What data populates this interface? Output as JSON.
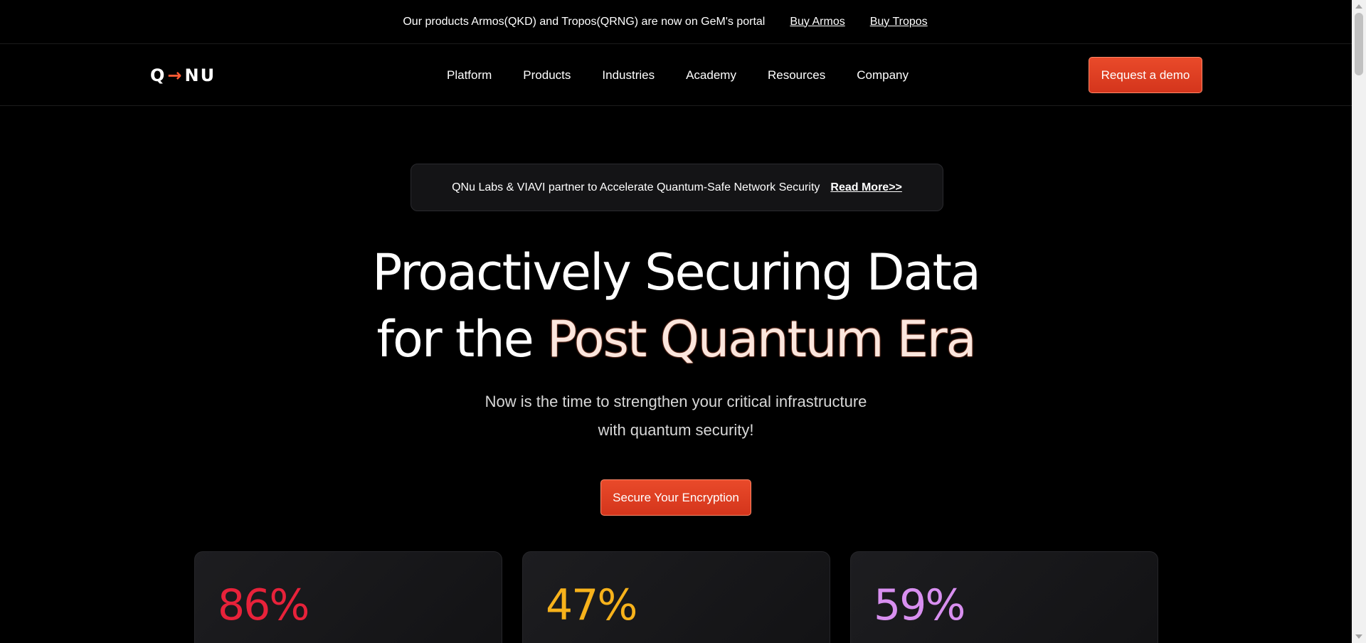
{
  "announcement": {
    "message": "Our products Armos(QKD) and Tropos(QRNG) are now on GeM's portal",
    "link1": "Buy Armos",
    "link2": "Buy Tropos"
  },
  "nav": {
    "logo_left": "Q",
    "logo_arrow": "→",
    "logo_right": "NU",
    "items": [
      "Platform",
      "Products",
      "Industries",
      "Academy",
      "Resources",
      "Company"
    ],
    "demo_button": "Request a demo"
  },
  "news": {
    "text": "QNu Labs & VIAVI partner to Accelerate Quantum-Safe Network Security",
    "link": "Read More>>"
  },
  "hero": {
    "line1": "Proactively Securing Data",
    "line2_prefix": "for the ",
    "line2_highlight": "Post Quantum Era",
    "sub_line1": "Now is the time to strengthen your critical infrastructure",
    "sub_line2": "with quantum security!",
    "cta": "Secure Your Encryption"
  },
  "stats": [
    {
      "value": "86%",
      "color": "#e8223a"
    },
    {
      "value": "47%",
      "color": "#f7b21b"
    },
    {
      "value": "59%",
      "color": "#d88ff0"
    }
  ]
}
